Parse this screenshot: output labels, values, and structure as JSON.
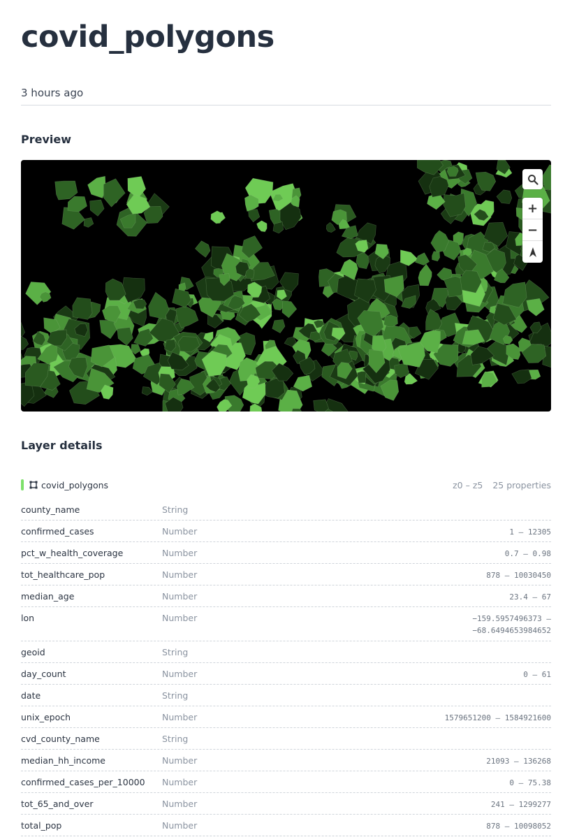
{
  "header": {
    "title": "covid_polygons",
    "updated": "3 hours ago"
  },
  "preview": {
    "heading": "Preview",
    "controls": {
      "search_icon": "search-icon",
      "zoom_in": "+",
      "zoom_out": "−",
      "compass_icon": "compass-icon"
    }
  },
  "layer_details": {
    "heading": "Layer details",
    "layer": {
      "name": "covid_polygons",
      "zoom_range": "z0 – z5",
      "property_count": "25 properties",
      "accent": "#7de06a"
    },
    "properties": [
      {
        "name": "county_name",
        "type": "String",
        "range": ""
      },
      {
        "name": "confirmed_cases",
        "type": "Number",
        "range": "1 – 12305"
      },
      {
        "name": "pct_w_health_coverage",
        "type": "Number",
        "range": "0.7 – 0.98"
      },
      {
        "name": "tot_healthcare_pop",
        "type": "Number",
        "range": "878 – 10030450"
      },
      {
        "name": "median_age",
        "type": "Number",
        "range": "23.4 – 67"
      },
      {
        "name": "lon",
        "type": "Number",
        "range": "−159.5957496373 –",
        "range2": "−68.6494653984652"
      },
      {
        "name": "geoid",
        "type": "String",
        "range": ""
      },
      {
        "name": "day_count",
        "type": "Number",
        "range": "0 – 61"
      },
      {
        "name": "date",
        "type": "String",
        "range": ""
      },
      {
        "name": "unix_epoch",
        "type": "Number",
        "range": "1579651200 – 1584921600"
      },
      {
        "name": "cvd_county_name",
        "type": "String",
        "range": ""
      },
      {
        "name": "median_hh_income",
        "type": "Number",
        "range": "21093 – 136268"
      },
      {
        "name": "confirmed_cases_per_10000",
        "type": "Number",
        "range": "0 – 75.38"
      },
      {
        "name": "tot_65_and_over",
        "type": "Number",
        "range": "241 – 1299277"
      },
      {
        "name": "total_pop",
        "type": "Number",
        "range": "878 – 10098052"
      }
    ]
  }
}
